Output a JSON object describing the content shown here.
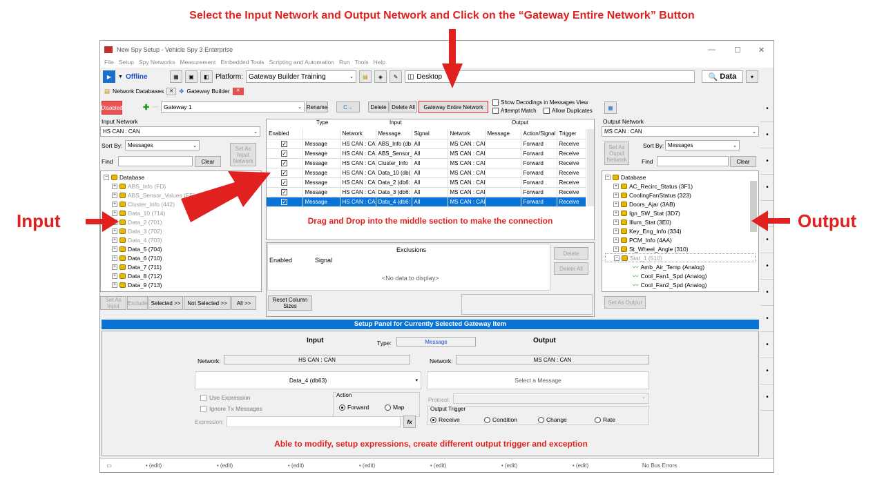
{
  "annotations": {
    "top": "Select the Input Network and Output Network and Click on the “Gateway Entire Network” Button",
    "left": "Input",
    "right": "Output",
    "middle": "Drag and Drop into the middle section to make the connection",
    "bottom": "Able to modify, setup expressions, create different output trigger and exception",
    "color": "#e0211f"
  },
  "window": {
    "title": "New Spy Setup - Vehicle Spy 3 Enterprise",
    "controls": [
      "—",
      "☐",
      "✕"
    ]
  },
  "menu": [
    "File",
    "Setup",
    "Spy Networks",
    "Measurement",
    "Embedded Tools",
    "Scripting and Automation",
    "Run",
    "Tools",
    "Help"
  ],
  "toolbar": {
    "status": "Offline",
    "platform_label": "Platform:",
    "platform_value": "Gateway Builder Training",
    "desktop_label": "Desktop",
    "data_label": "Data"
  },
  "tabs": {
    "network_databases": "Network Databases",
    "gateway_builder": "Gateway Builder"
  },
  "gateway_bar": {
    "disabled_badge": "Disabled",
    "gateway_name": "Gateway 1",
    "rename": "Rename",
    "undo": "C→",
    "delete": "Delete",
    "delete_all": "Delete All",
    "gateway_entire_network": "Gateway Entire Network",
    "show_decodings": "Show Decodings in Messages View",
    "attempt_match": "Attempt Match",
    "allow_duplicates": "Allow Duplicates"
  },
  "input_panel": {
    "title": "Input Network",
    "network": "HS CAN : CAN",
    "sort_label": "Sort By:",
    "sort_value": "Messages",
    "set_as": "Set As Input Network",
    "find_label": "Find",
    "clear": "Clear",
    "tree_root": "Database",
    "items": [
      "ABS_Info (FD)",
      "ABS_Sensor_Values (FE)",
      "Cluster_Info (442)",
      "Data_10 (714)",
      "Data_2 (701)",
      "Data_3 (702)",
      "Data_4 (703)",
      "Data_5 (704)",
      "Data_6 (710)",
      "Data_7 (711)",
      "Data_8 (712)",
      "Data_9 (713)"
    ],
    "footer": [
      "Set As Input",
      "Exclude",
      "Selected >>",
      "Not Selected >>",
      "All >>"
    ]
  },
  "grid": {
    "group_type": "Type",
    "group_input": "Input",
    "group_output": "Output",
    "headers": [
      "Enabled",
      "",
      "Network",
      "Message",
      "Signal",
      "Network",
      "Message",
      "Action/Signal",
      "Trigger"
    ],
    "rows": [
      [
        "Message",
        "HS CAN : CAI",
        "ABS_Info (db",
        "All",
        "MS CAN : CAI",
        "",
        "Forward",
        "Receive"
      ],
      [
        "Message",
        "HS CAN : CAI",
        "ABS_Sensor_",
        "All",
        "MS CAN : CAI",
        "",
        "Forward",
        "Receive"
      ],
      [
        "Message",
        "HS CAN : CAI",
        "Cluster_Info",
        "All",
        "MS CAN : CAI",
        "",
        "Forward",
        "Receive"
      ],
      [
        "Message",
        "HS CAN : CAI",
        "Data_10 (db(",
        "All",
        "MS CAN : CAI",
        "",
        "Forward",
        "Receive"
      ],
      [
        "Message",
        "HS CAN : CAI",
        "Data_2 (db6:",
        "All",
        "MS CAN : CAI",
        "",
        "Forward",
        "Receive"
      ],
      [
        "Message",
        "HS CAN : CAI",
        "Data_3 (db6:",
        "All",
        "MS CAN : CAI",
        "",
        "Forward",
        "Receive"
      ],
      [
        "Message",
        "HS CAN : CAI",
        "Data_4 (db6:",
        "All",
        "MS CAN : CAI",
        "",
        "Forward",
        "Receive"
      ]
    ],
    "selected_row": 6
  },
  "exclusions": {
    "title": "Exclusions",
    "col_enabled": "Enabled",
    "col_signal": "Signal",
    "empty": "<No data to display>",
    "delete": "Delete",
    "delete_all": "Delete All",
    "reset_columns": "Reset Column Sizes"
  },
  "output_panel": {
    "title": "Output Network",
    "network": "MS CAN : CAN",
    "set_as": "Set As Ouput Network",
    "sort_label": "Sort By:",
    "sort_value": "Messages",
    "find_label": "Find",
    "clear": "Clear",
    "tree_root": "Database",
    "items": [
      "AC_Recirc_Status (3F1)",
      "CoolingFanStatus (323)",
      "Doors_Ajar (3AB)",
      "Ign_SW_Stat (3D7)",
      "Illum_Stat (3E0)",
      "Key_Eng_Info (334)",
      "PCM_Info (4AA)",
      "St_Wheel_Angle (310)",
      "Stat_1 (510)"
    ],
    "signals": [
      "Amb_Air_Temp (Analog)",
      "Cool_Fan1_Spd (Analog)",
      "Cool_Fan2_Spd (Analog)"
    ],
    "footer": "Set As Output"
  },
  "setup": {
    "title": "Setup Panel for Currently Selected Gateway Item",
    "input_label": "Input",
    "type_label": "Type:",
    "type_value": "Message",
    "output_label": "Output",
    "network_label": "Network:",
    "input_network": "HS CAN : CAN",
    "output_network": "MS CAN : CAN",
    "input_message": "Data_4 (db63)",
    "output_message": "Select a Message",
    "use_expression": "Use Expression",
    "ignore_tx": "Ignore Tx Messages",
    "action_label": "Action",
    "forward": "Forward",
    "map": "Map",
    "protocol_label": "Protocol:",
    "output_trigger": "Output Trigger",
    "receive": "Receive",
    "condition": "Condition",
    "change": "Change",
    "rate": "Rate",
    "expression_label": "Expression:",
    "fx": "fx"
  },
  "status": {
    "items": [
      "• (edit)",
      "• (edit)",
      "• (edit)",
      "• (edit)",
      "• (edit)",
      "• (edit)",
      "• (edit)"
    ],
    "bus": "No Bus Errors"
  },
  "right_strip": [
    "•",
    "•",
    "•",
    "•",
    "•",
    "•",
    "•",
    "•",
    "•",
    "•",
    "•",
    "•"
  ]
}
